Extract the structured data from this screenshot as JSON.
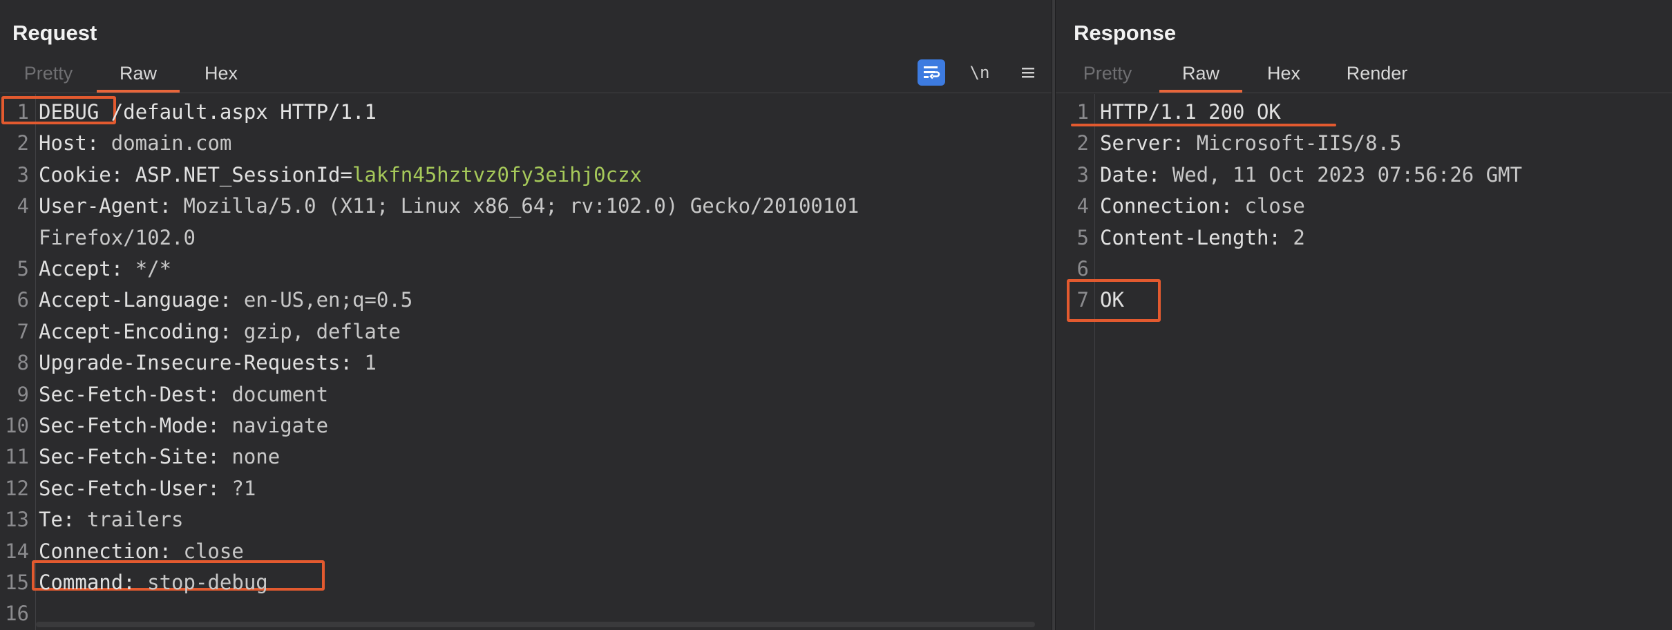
{
  "request": {
    "title": "Request",
    "tabs": [
      {
        "label": "Pretty",
        "state": "disabled"
      },
      {
        "label": "Raw",
        "state": "active"
      },
      {
        "label": "Hex",
        "state": "normal"
      }
    ],
    "tools": {
      "wrap_icon": "word-wrap-icon",
      "newline_label": "\\n",
      "menu_icon": "hamburger-menu-icon"
    },
    "lines": [
      {
        "n": "1",
        "parts": [
          {
            "t": "DEBUG",
            "c": "k"
          },
          {
            "t": " /default.aspx HTTP/1.1",
            "c": "url"
          }
        ]
      },
      {
        "n": "2",
        "parts": [
          {
            "t": "Host: ",
            "c": "k"
          },
          {
            "t": "domain.com",
            "c": "v"
          }
        ]
      },
      {
        "n": "3",
        "parts": [
          {
            "t": "Cookie: ",
            "c": "k"
          },
          {
            "t": "ASP.NET_SessionId=",
            "c": "k"
          },
          {
            "t": "lakfn45hztvz0fy3eihj0czx",
            "c": "g"
          }
        ]
      },
      {
        "n": "4",
        "parts": [
          {
            "t": "User-Agent: ",
            "c": "k"
          },
          {
            "t": "Mozilla/5.0 (X11; Linux x86_64; rv:102.0) Gecko/20100101",
            "c": "v"
          }
        ]
      },
      {
        "n": "",
        "parts": [
          {
            "t": "Firefox/102.0",
            "c": "v"
          }
        ]
      },
      {
        "n": "5",
        "parts": [
          {
            "t": "Accept: ",
            "c": "k"
          },
          {
            "t": "*/*",
            "c": "v"
          }
        ]
      },
      {
        "n": "6",
        "parts": [
          {
            "t": "Accept-Language: ",
            "c": "k"
          },
          {
            "t": "en-US,en;q=0.5",
            "c": "v"
          }
        ]
      },
      {
        "n": "7",
        "parts": [
          {
            "t": "Accept-Encoding: ",
            "c": "k"
          },
          {
            "t": "gzip, deflate",
            "c": "v"
          }
        ]
      },
      {
        "n": "8",
        "parts": [
          {
            "t": "Upgrade-Insecure-Requests: ",
            "c": "k"
          },
          {
            "t": "1",
            "c": "v"
          }
        ]
      },
      {
        "n": "9",
        "parts": [
          {
            "t": "Sec-Fetch-Dest: ",
            "c": "k"
          },
          {
            "t": "document",
            "c": "v"
          }
        ]
      },
      {
        "n": "10",
        "parts": [
          {
            "t": "Sec-Fetch-Mode: ",
            "c": "k"
          },
          {
            "t": "navigate",
            "c": "v"
          }
        ]
      },
      {
        "n": "11",
        "parts": [
          {
            "t": "Sec-Fetch-Site: ",
            "c": "k"
          },
          {
            "t": "none",
            "c": "v"
          }
        ]
      },
      {
        "n": "12",
        "parts": [
          {
            "t": "Sec-Fetch-User: ",
            "c": "k"
          },
          {
            "t": "?1",
            "c": "v"
          }
        ]
      },
      {
        "n": "13",
        "parts": [
          {
            "t": "Te: ",
            "c": "k"
          },
          {
            "t": "trailers",
            "c": "v"
          }
        ]
      },
      {
        "n": "14",
        "parts": [
          {
            "t": "Connection: ",
            "c": "k"
          },
          {
            "t": "close",
            "c": "v"
          }
        ]
      },
      {
        "n": "15",
        "parts": [
          {
            "t": "Command: ",
            "c": "k"
          },
          {
            "t": "stop-debug",
            "c": "v"
          }
        ]
      },
      {
        "n": "16",
        "parts": []
      }
    ]
  },
  "response": {
    "title": "Response",
    "tabs": [
      {
        "label": "Pretty",
        "state": "disabled"
      },
      {
        "label": "Raw",
        "state": "active"
      },
      {
        "label": "Hex",
        "state": "normal"
      },
      {
        "label": "Render",
        "state": "normal"
      }
    ],
    "lines": [
      {
        "n": "1",
        "parts": [
          {
            "t": "HTTP/1.1 200 OK",
            "c": "k"
          }
        ]
      },
      {
        "n": "2",
        "parts": [
          {
            "t": "Server: ",
            "c": "k"
          },
          {
            "t": "Microsoft-IIS/8.5",
            "c": "v"
          }
        ]
      },
      {
        "n": "3",
        "parts": [
          {
            "t": "Date: ",
            "c": "k"
          },
          {
            "t": "Wed, 11 Oct 2023 07:56:26 GMT",
            "c": "v"
          }
        ]
      },
      {
        "n": "4",
        "parts": [
          {
            "t": "Connection: ",
            "c": "k"
          },
          {
            "t": "close",
            "c": "v"
          }
        ]
      },
      {
        "n": "5",
        "parts": [
          {
            "t": "Content-Length: ",
            "c": "k"
          },
          {
            "t": "2",
            "c": "v"
          }
        ]
      },
      {
        "n": "6",
        "parts": []
      },
      {
        "n": "7",
        "parts": [
          {
            "t": "OK",
            "c": "k"
          }
        ]
      }
    ]
  },
  "colors": {
    "highlight": "#e35a2f",
    "active_tab_underline": "#e8663b",
    "cookie_value": "#a6c95a",
    "wrap_button": "#3d7be0"
  }
}
